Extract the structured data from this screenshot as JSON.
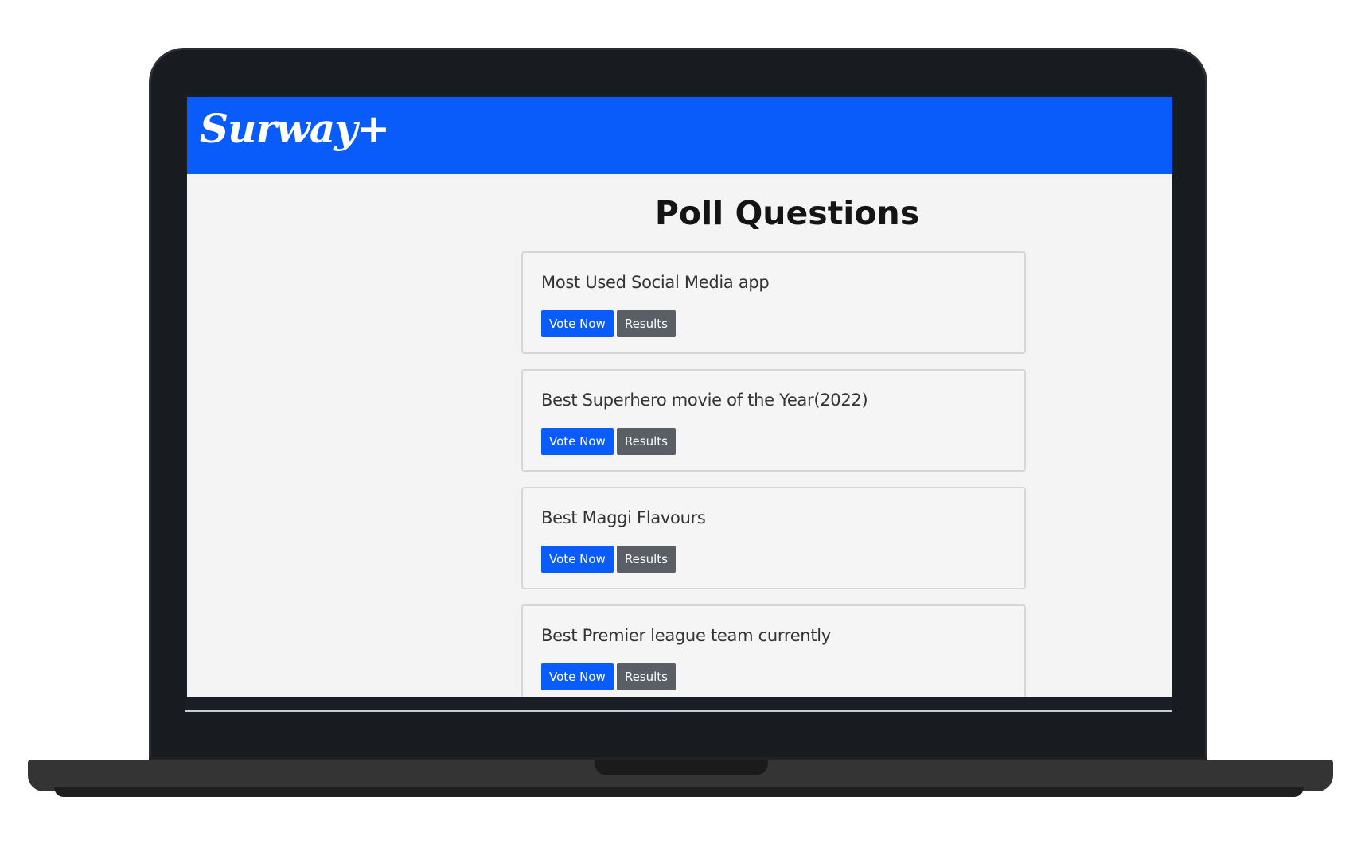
{
  "navbar": {
    "brand": "Surway+"
  },
  "main": {
    "title": "Poll Questions",
    "polls": [
      {
        "question": "Most Used Social Media app",
        "vote_label": "Vote Now",
        "results_label": "Results"
      },
      {
        "question": "Best Superhero movie of the Year(2022)",
        "vote_label": "Vote Now",
        "results_label": "Results"
      },
      {
        "question": "Best Maggi Flavours",
        "vote_label": "Vote Now",
        "results_label": "Results"
      },
      {
        "question": "Best Premier league team currently",
        "vote_label": "Vote Now",
        "results_label": "Results"
      }
    ]
  },
  "colors": {
    "brand_blue": "#0a5cfa",
    "results_gray": "#5a5f66",
    "page_bg": "#f4f4f4"
  }
}
